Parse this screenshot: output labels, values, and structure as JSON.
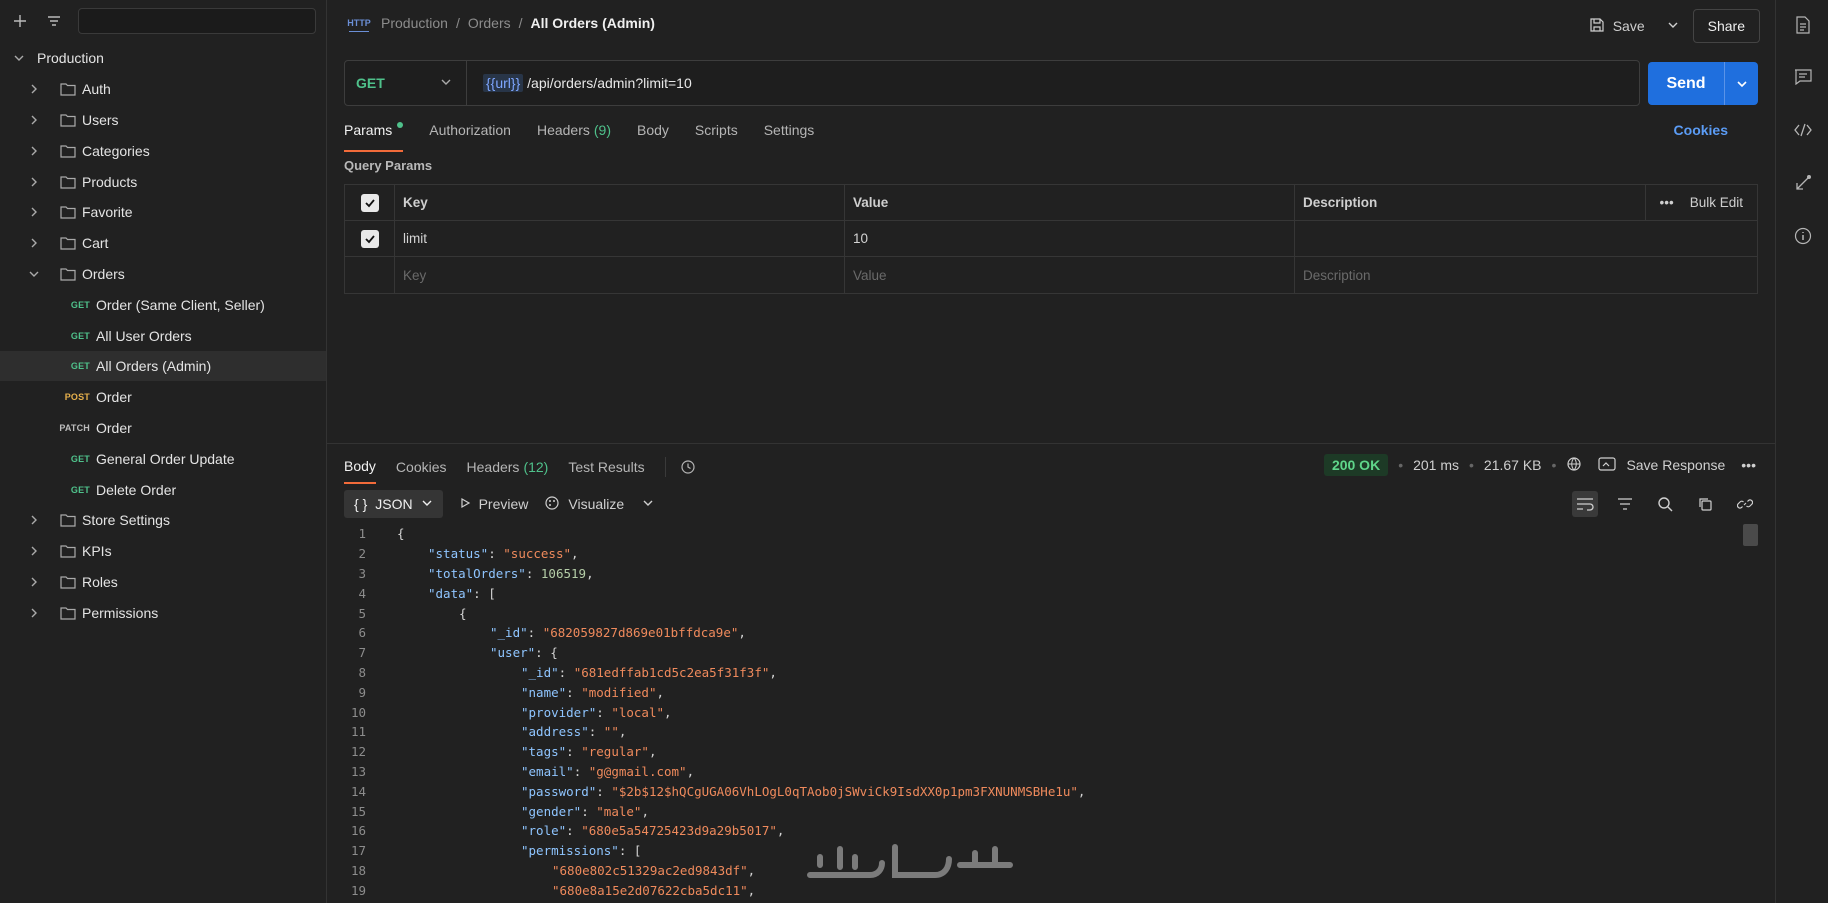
{
  "sidebar": {
    "root": "Production",
    "folders": {
      "auth": "Auth",
      "users": "Users",
      "categories": "Categories",
      "products": "Products",
      "favorite": "Favorite",
      "cart": "Cart",
      "orders": "Orders",
      "store_settings": "Store Settings",
      "kpis": "KPIs",
      "roles": "Roles",
      "permissions": "Permissions"
    },
    "requests": [
      {
        "method": "GET",
        "name": "Order (Same Client, Seller)"
      },
      {
        "method": "GET",
        "name": "All User Orders"
      },
      {
        "method": "GET",
        "name": "All Orders (Admin)"
      },
      {
        "method": "POST",
        "name": "Order"
      },
      {
        "method": "PATCH",
        "name": "Order"
      },
      {
        "method": "GET",
        "name": "General Order Update"
      },
      {
        "method": "GET",
        "name": "Delete Order"
      }
    ]
  },
  "header": {
    "breadcrumb": [
      "Production",
      "Orders",
      "All Orders (Admin)"
    ],
    "http_badge": "HTTP",
    "save_label": "Save",
    "share_label": "Share"
  },
  "request": {
    "method": "GET",
    "url_var": "{{url}}",
    "url_path": "/api/orders/admin?limit=10",
    "send_label": "Send",
    "tabs": {
      "params": "Params",
      "authorization": "Authorization",
      "headers": "Headers",
      "headers_count": "(9)",
      "body": "Body",
      "scripts": "Scripts",
      "settings": "Settings"
    },
    "cookies_label": "Cookies",
    "query_params_title": "Query Params",
    "table": {
      "col_key": "Key",
      "col_value": "Value",
      "col_desc": "Description",
      "bulk_edit": "Bulk Edit",
      "rows": [
        {
          "key": "limit",
          "value": "10"
        }
      ],
      "placeholder_key": "Key",
      "placeholder_value": "Value",
      "placeholder_desc": "Description"
    }
  },
  "response": {
    "tabs": {
      "body": "Body",
      "cookies": "Cookies",
      "headers": "Headers",
      "headers_count": "(12)",
      "test_results": "Test Results"
    },
    "status": "200 OK",
    "time": "201 ms",
    "size": "21.67 KB",
    "save_response": "Save Response",
    "format": "JSON",
    "preview": "Preview",
    "visualize": "Visualize"
  },
  "code_lines": [
    {
      "n": "1",
      "indent": 0,
      "parts": [
        [
          "p",
          "{"
        ]
      ]
    },
    {
      "n": "2",
      "indent": 1,
      "parts": [
        [
          "k",
          "\"status\""
        ],
        [
          "p",
          ": "
        ],
        [
          "s",
          "\"success\""
        ],
        [
          "p",
          ","
        ]
      ]
    },
    {
      "n": "3",
      "indent": 1,
      "parts": [
        [
          "k",
          "\"totalOrders\""
        ],
        [
          "p",
          ": "
        ],
        [
          "n",
          "106519"
        ],
        [
          "p",
          ","
        ]
      ]
    },
    {
      "n": "4",
      "indent": 1,
      "parts": [
        [
          "k",
          "\"data\""
        ],
        [
          "p",
          ": ["
        ]
      ]
    },
    {
      "n": "5",
      "indent": 2,
      "parts": [
        [
          "p",
          "{"
        ]
      ]
    },
    {
      "n": "6",
      "indent": 3,
      "parts": [
        [
          "k",
          "\"_id\""
        ],
        [
          "p",
          ": "
        ],
        [
          "s",
          "\"682059827d869e01bffdca9e\""
        ],
        [
          "p",
          ","
        ]
      ]
    },
    {
      "n": "7",
      "indent": 3,
      "parts": [
        [
          "k",
          "\"user\""
        ],
        [
          "p",
          ": {"
        ]
      ]
    },
    {
      "n": "8",
      "indent": 4,
      "parts": [
        [
          "k",
          "\"_id\""
        ],
        [
          "p",
          ": "
        ],
        [
          "s",
          "\"681edffab1cd5c2ea5f31f3f\""
        ],
        [
          "p",
          ","
        ]
      ]
    },
    {
      "n": "9",
      "indent": 4,
      "parts": [
        [
          "k",
          "\"name\""
        ],
        [
          "p",
          ": "
        ],
        [
          "s",
          "\"modified\""
        ],
        [
          "p",
          ","
        ]
      ]
    },
    {
      "n": "10",
      "indent": 4,
      "parts": [
        [
          "k",
          "\"provider\""
        ],
        [
          "p",
          ": "
        ],
        [
          "s",
          "\"local\""
        ],
        [
          "p",
          ","
        ]
      ]
    },
    {
      "n": "11",
      "indent": 4,
      "parts": [
        [
          "k",
          "\"address\""
        ],
        [
          "p",
          ": "
        ],
        [
          "s",
          "\"\""
        ],
        [
          "p",
          ","
        ]
      ]
    },
    {
      "n": "12",
      "indent": 4,
      "parts": [
        [
          "k",
          "\"tags\""
        ],
        [
          "p",
          ": "
        ],
        [
          "s",
          "\"regular\""
        ],
        [
          "p",
          ","
        ]
      ]
    },
    {
      "n": "13",
      "indent": 4,
      "parts": [
        [
          "k",
          "\"email\""
        ],
        [
          "p",
          ": "
        ],
        [
          "s",
          "\"g@gmail.com\""
        ],
        [
          "p",
          ","
        ]
      ]
    },
    {
      "n": "14",
      "indent": 4,
      "parts": [
        [
          "k",
          "\"password\""
        ],
        [
          "p",
          ": "
        ],
        [
          "s",
          "\"$2b$12$hQCgUGA06VhLOgL0qTAob0jSWviCk9IsdXX0p1pm3FXNUNMSBHe1u\""
        ],
        [
          "p",
          ","
        ]
      ]
    },
    {
      "n": "15",
      "indent": 4,
      "parts": [
        [
          "k",
          "\"gender\""
        ],
        [
          "p",
          ": "
        ],
        [
          "s",
          "\"male\""
        ],
        [
          "p",
          ","
        ]
      ]
    },
    {
      "n": "16",
      "indent": 4,
      "parts": [
        [
          "k",
          "\"role\""
        ],
        [
          "p",
          ": "
        ],
        [
          "s",
          "\"680e5a54725423d9a29b5017\""
        ],
        [
          "p",
          ","
        ]
      ]
    },
    {
      "n": "17",
      "indent": 4,
      "parts": [
        [
          "k",
          "\"permissions\""
        ],
        [
          "p",
          ": ["
        ]
      ]
    },
    {
      "n": "18",
      "indent": 5,
      "parts": [
        [
          "s",
          "\"680e802c51329ac2ed9843df\""
        ],
        [
          "p",
          ","
        ]
      ]
    },
    {
      "n": "19",
      "indent": 5,
      "parts": [
        [
          "s",
          "\"680e8a15e2d07622cba5dc11\""
        ],
        [
          "p",
          ","
        ]
      ]
    }
  ],
  "colors": {
    "accent": "#f26b3a",
    "send": "#1f6fde",
    "get": "#4fc18b",
    "post": "#e6b04c",
    "link": "#5b9cf5"
  }
}
